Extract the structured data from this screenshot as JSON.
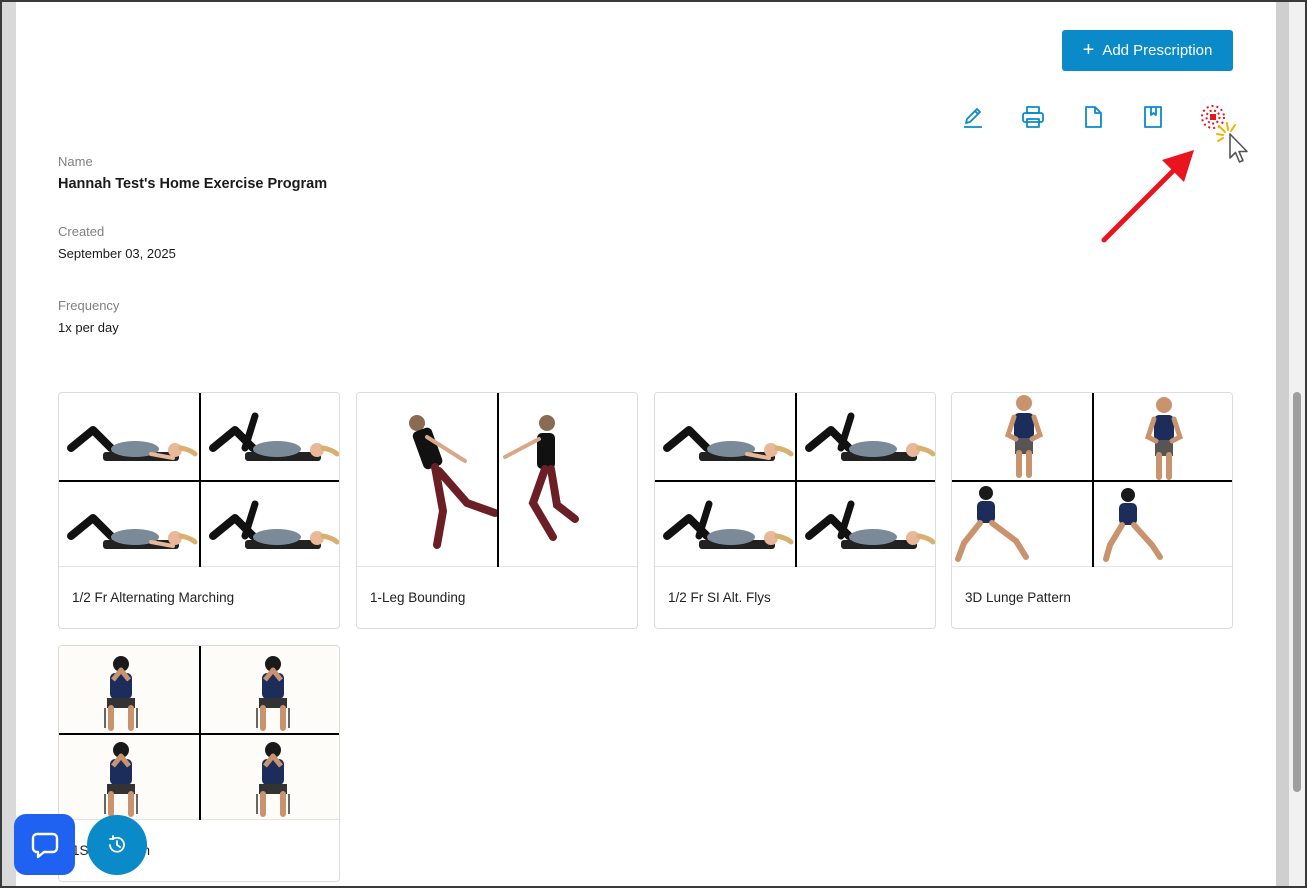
{
  "toolbar": {
    "add_prescription_label": "Add Prescription",
    "icons": [
      "edit-icon",
      "print-icon",
      "document-icon",
      "bookmark-icon",
      "target-icon"
    ],
    "accent_color": "#0a8ac9"
  },
  "program": {
    "name_label": "Name",
    "name_value": "Hannah Test's Home Exercise Program",
    "created_label": "Created",
    "created_value": "September 03, 2025",
    "frequency_label": "Frequency",
    "frequency_value": "1x per day"
  },
  "exercises": [
    {
      "title": "1/2 Fr Alternating Marching"
    },
    {
      "title": "1-Leg Bounding"
    },
    {
      "title": "1/2 Fr SI Alt. Flys"
    },
    {
      "title": "3D Lunge Pattern"
    },
    {
      "title": "1St... Stretch"
    }
  ],
  "annotation": {
    "arrow_color": "#e8141e"
  },
  "floating": {
    "chat_color": "#1f61f0",
    "history_color": "#0a8ac9"
  }
}
